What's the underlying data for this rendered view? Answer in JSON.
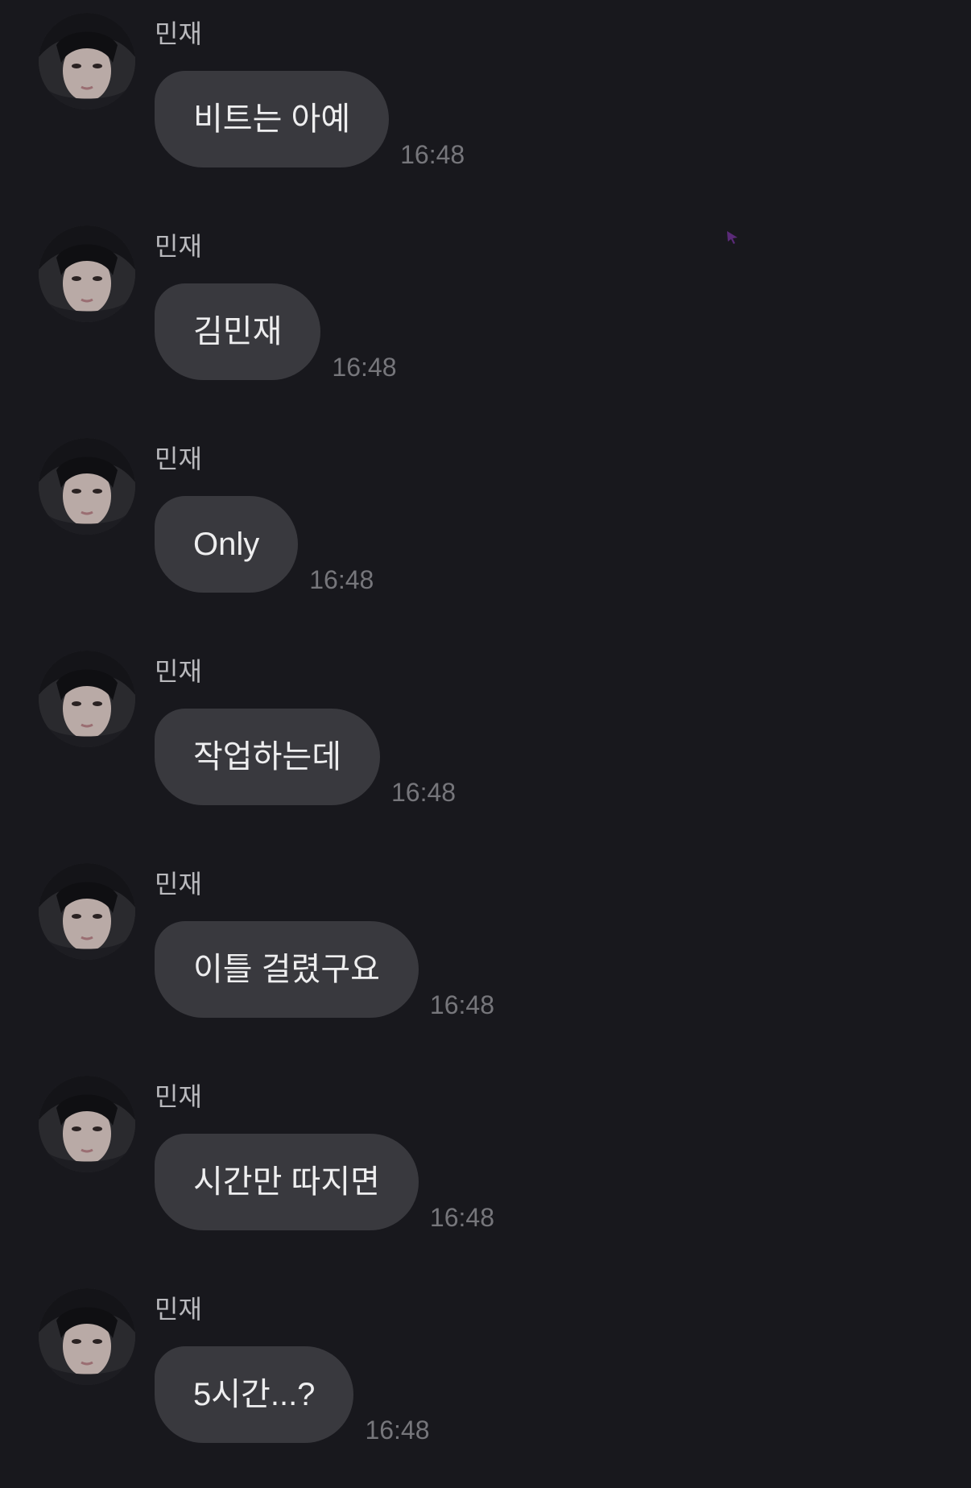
{
  "colors": {
    "background": "#18181d",
    "bubble": "#39393e",
    "bubble_text": "#eeeeef",
    "sender_text": "#b9b9bd",
    "time_text": "#76767b"
  },
  "messages": [
    {
      "sender": "민재",
      "text": "비트는 아예",
      "time": "16:48",
      "avatar": "profile-photo-icon"
    },
    {
      "sender": "민재",
      "text": "김민재",
      "time": "16:48",
      "avatar": "profile-photo-icon"
    },
    {
      "sender": "민재",
      "text": "Only",
      "time": "16:48",
      "avatar": "profile-photo-icon"
    },
    {
      "sender": "민재",
      "text": "작업하는데",
      "time": "16:48",
      "avatar": "profile-photo-icon"
    },
    {
      "sender": "민재",
      "text": "이틀 걸렸구요",
      "time": "16:48",
      "avatar": "profile-photo-icon"
    },
    {
      "sender": "민재",
      "text": "시간만 따지면",
      "time": "16:48",
      "avatar": "profile-photo-icon"
    },
    {
      "sender": "민재",
      "text": "5시간...?",
      "time": "16:48",
      "avatar": "profile-photo-icon"
    }
  ]
}
